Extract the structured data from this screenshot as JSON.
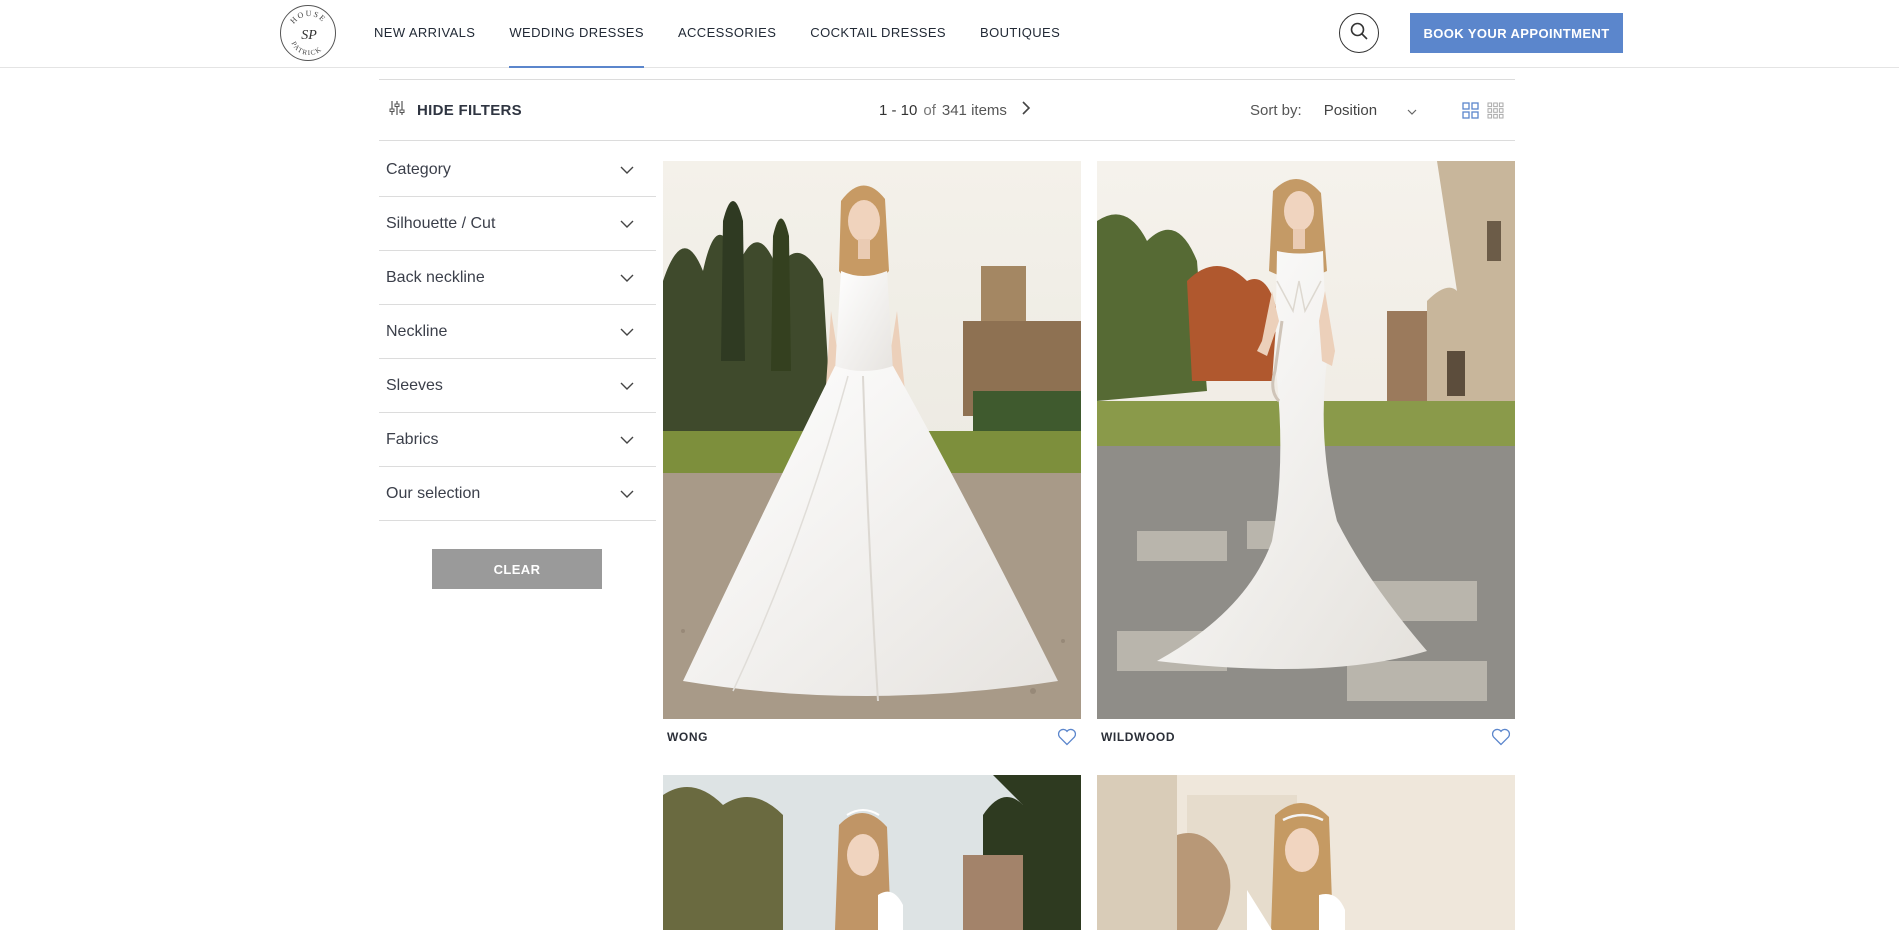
{
  "header": {
    "logo_text": "HOUSE SP PATRICK",
    "nav": [
      {
        "label": "NEW ARRIVALS",
        "active": false
      },
      {
        "label": "WEDDING DRESSES",
        "active": true
      },
      {
        "label": "ACCESSORIES",
        "active": false
      },
      {
        "label": "COCKTAIL DRESSES",
        "active": false
      },
      {
        "label": "BOUTIQUES",
        "active": false
      }
    ],
    "search_icon": "search-icon",
    "book_label": "BOOK YOUR APPOINTMENT"
  },
  "toolbar": {
    "hide_filters_label": "HIDE FILTERS",
    "range": "1 - 10",
    "of": "of",
    "total": "341 items",
    "sort_label": "Sort by:",
    "sort_value": "Position"
  },
  "filters": {
    "items": [
      {
        "label": "Category"
      },
      {
        "label": "Silhouette / Cut"
      },
      {
        "label": "Back neckline"
      },
      {
        "label": "Neckline"
      },
      {
        "label": "Sleeves"
      },
      {
        "label": "Fabrics"
      },
      {
        "label": "Our selection"
      }
    ],
    "clear_label": "CLEAR"
  },
  "products": [
    {
      "name": "WONG"
    },
    {
      "name": "WILDWOOD"
    },
    {
      "name": ""
    },
    {
      "name": ""
    }
  ],
  "colors": {
    "accent": "#5b86cc",
    "clear_button": "#9a9a9a",
    "text": "#3b3f4a"
  }
}
